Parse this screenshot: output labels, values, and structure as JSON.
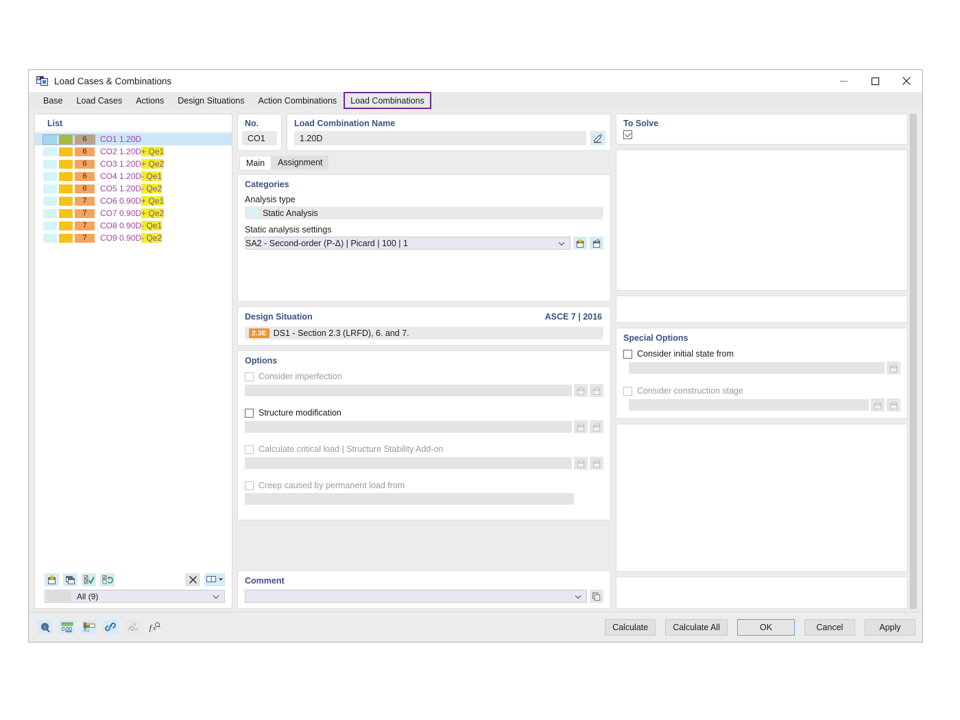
{
  "window": {
    "title": "Load Cases & Combinations",
    "app_icon": "load-cases-icon",
    "minimize": "minimize-icon",
    "maximize": "maximize-icon",
    "close": "close-icon"
  },
  "tabs": [
    {
      "label": "Base",
      "selected": false
    },
    {
      "label": "Load Cases",
      "selected": false
    },
    {
      "label": "Actions",
      "selected": false
    },
    {
      "label": "Design Situations",
      "selected": false
    },
    {
      "label": "Action Combinations",
      "selected": false
    },
    {
      "label": "Load Combinations",
      "selected": true
    }
  ],
  "list": {
    "title": "List",
    "rows": [
      {
        "sw1": "#9fd9f0",
        "sw2": "#a8b840",
        "sw3": "#bda286",
        "num": "6",
        "label": "CO1 1.20D",
        "hl": "",
        "selected": true
      },
      {
        "sw1": "#d4f5f7",
        "sw2": "#f5c219",
        "sw3": "#f5a45c",
        "num": "6",
        "label": "CO2 1.20D ",
        "hl": "+ Qe1",
        "selected": false
      },
      {
        "sw1": "#d4f5f7",
        "sw2": "#f5c219",
        "sw3": "#f5a45c",
        "num": "6",
        "label": "CO3 1.20D ",
        "hl": "+ Qe2",
        "selected": false
      },
      {
        "sw1": "#d4f5f7",
        "sw2": "#f5c219",
        "sw3": "#f5a45c",
        "num": "6",
        "label": "CO4 1.20D ",
        "hl": "- Qe1",
        "selected": false
      },
      {
        "sw1": "#d4f5f7",
        "sw2": "#f5c219",
        "sw3": "#f5a45c",
        "num": "6",
        "label": "CO5 1.20D ",
        "hl": "- Qe2",
        "selected": false
      },
      {
        "sw1": "#d4f5f7",
        "sw2": "#f5c219",
        "sw3": "#f5a45c",
        "num": "7",
        "label": "CO6 0.90D ",
        "hl": "+ Qe1",
        "selected": false
      },
      {
        "sw1": "#d4f5f7",
        "sw2": "#f5c219",
        "sw3": "#f5a45c",
        "num": "7",
        "label": "CO7 0.90D ",
        "hl": "+ Qe2",
        "selected": false
      },
      {
        "sw1": "#d4f5f7",
        "sw2": "#f5c219",
        "sw3": "#f5a45c",
        "num": "7",
        "label": "CO8 0.90D ",
        "hl": "- Qe1",
        "selected": false
      },
      {
        "sw1": "#d4f5f7",
        "sw2": "#f5c219",
        "sw3": "#f5a45c",
        "num": "7",
        "label": "CO9 0.90D ",
        "hl": "- Qe2",
        "selected": false
      }
    ],
    "tools": [
      {
        "name": "new-load-combination-icon",
        "enabled": true
      },
      {
        "name": "copy-load-combination-icon",
        "enabled": true
      },
      {
        "name": "select-all-icon",
        "enabled": true
      },
      {
        "name": "invert-selection-icon",
        "enabled": true
      }
    ],
    "delete_icon": "delete-icon",
    "columns_icon": "columns-icon",
    "filter_value": "All (9)"
  },
  "detail": {
    "no_label": "No.",
    "no_value": "CO1",
    "name_label": "Load Combination Name",
    "name_value": "1.20D",
    "name_edit_icon": "edit-icon",
    "to_solve_label": "To Solve",
    "to_solve_checked": true,
    "subtabs": [
      {
        "label": "Main",
        "active": true
      },
      {
        "label": "Assignment",
        "active": false
      }
    ],
    "categories": {
      "title": "Categories",
      "analysis_type_label": "Analysis type",
      "analysis_type_value": "Static Analysis",
      "analysis_type_color": "#d4f5f7",
      "settings_label": "Static analysis settings",
      "settings_value": "SA2 - Second-order (P-Δ) | Picard | 100 | 1",
      "settings_color": "#f5c219",
      "new_icon": "new-icon",
      "edit_icon": "edit-settings-icon"
    },
    "design_situation": {
      "title": "Design Situation",
      "standard": "ASCE 7 | 2016",
      "badge": "2.3E",
      "badge_color": "#f0922b",
      "value": "DS1 - Section 2.3 (LRFD), 6. and 7."
    },
    "options": {
      "title": "Options",
      "items": [
        {
          "label": "Consider imperfection",
          "checked": false,
          "enabled": false,
          "has_field": true,
          "buttons": [
            "new-icon",
            "edit-icon"
          ]
        },
        {
          "label": "Structure modification",
          "checked": false,
          "enabled": true,
          "has_field": true,
          "buttons": [
            "new-icon",
            "edit-icon"
          ]
        },
        {
          "label": "Calculate critical load | Structure Stability Add-on",
          "checked": false,
          "enabled": false,
          "has_field": true,
          "buttons": [
            "new-icon",
            "edit-icon"
          ]
        },
        {
          "label": "Creep caused by permanent load from",
          "checked": false,
          "enabled": false,
          "has_field": true,
          "buttons": []
        }
      ]
    },
    "special_options": {
      "title": "Special Options",
      "items": [
        {
          "label": "Consider initial state from",
          "checked": false,
          "enabled": true,
          "has_field": true,
          "buttons": [
            "edit-icon"
          ]
        },
        {
          "label": "Consider construction stage",
          "checked": false,
          "enabled": false,
          "has_field": true,
          "buttons": [
            "new-icon",
            "edit-icon"
          ]
        }
      ]
    },
    "comment": {
      "title": "Comment",
      "value": "",
      "copy_icon": "copy-icon"
    }
  },
  "footer": {
    "tools": [
      {
        "name": "info-icon",
        "enabled": true
      },
      {
        "name": "units-icon",
        "enabled": true
      },
      {
        "name": "colors-icon",
        "enabled": true
      },
      {
        "name": "link-icon",
        "enabled": true
      },
      {
        "name": "snap-icon",
        "enabled": false
      },
      {
        "name": "formula-icon",
        "enabled": true
      }
    ],
    "buttons": [
      {
        "label": "Calculate",
        "primary": false
      },
      {
        "label": "Calculate All",
        "primary": false
      },
      {
        "label": "OK",
        "primary": true
      },
      {
        "label": "Cancel",
        "primary": false
      },
      {
        "label": "Apply",
        "primary": false
      }
    ]
  }
}
